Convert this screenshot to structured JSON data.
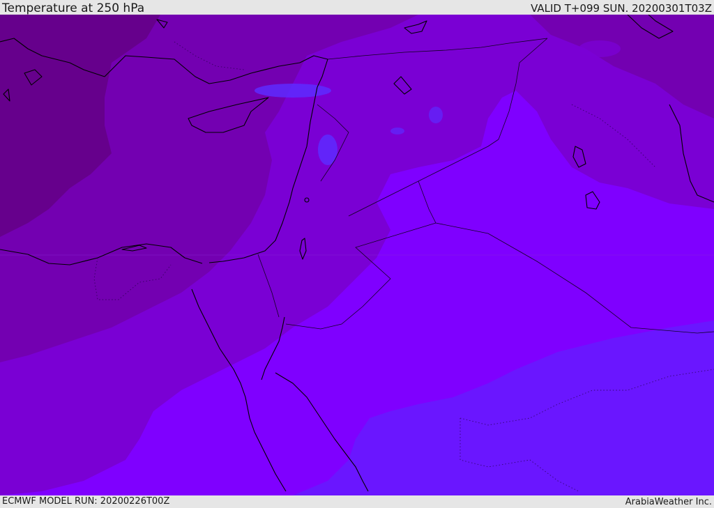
{
  "header": {
    "title": "Temperature at 250 hPa",
    "valid": "VALID T+099 SUN. 20200301T03Z"
  },
  "footer": {
    "model_run": "ECMWF MODEL RUN: 20200226T00Z",
    "credit": "ArabiaWeather Inc."
  },
  "map": {
    "colors": {
      "band_darkest": "#66008c",
      "band_dark": "#7300b1",
      "band_mid": "#7a00d4",
      "band_violet": "#7f00ff",
      "band_blue_violet": "#6a16ff",
      "patch_blue": "#5e2aff",
      "coast": "#000000"
    }
  }
}
